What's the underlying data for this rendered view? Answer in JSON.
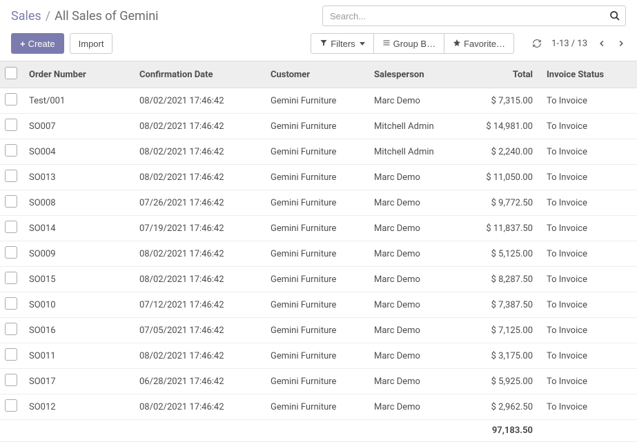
{
  "breadcrumb": {
    "root": "Sales",
    "sep": "/",
    "current": "All Sales of Gemini"
  },
  "search": {
    "placeholder": "Search..."
  },
  "buttons": {
    "create": "Create",
    "import": "Import",
    "filters": "Filters",
    "groupby": "Group B…",
    "favorites": "Favorite…"
  },
  "pager": {
    "text": "1-13 / 13"
  },
  "columns": {
    "order": "Order Number",
    "date": "Confirmation Date",
    "customer": "Customer",
    "salesperson": "Salesperson",
    "total": "Total",
    "invoice": "Invoice Status"
  },
  "rows": [
    {
      "order": "Test/001",
      "date": "08/02/2021 17:46:42",
      "customer": "Gemini Furniture",
      "salesperson": "Marc Demo",
      "total": "$ 7,315.00",
      "invoice": "To Invoice"
    },
    {
      "order": "SO007",
      "date": "08/02/2021 17:46:42",
      "customer": "Gemini Furniture",
      "salesperson": "Mitchell Admin",
      "total": "$ 14,981.00",
      "invoice": "To Invoice"
    },
    {
      "order": "SO004",
      "date": "08/02/2021 17:46:42",
      "customer": "Gemini Furniture",
      "salesperson": "Mitchell Admin",
      "total": "$ 2,240.00",
      "invoice": "To Invoice"
    },
    {
      "order": "SO013",
      "date": "08/02/2021 17:46:42",
      "customer": "Gemini Furniture",
      "salesperson": "Marc Demo",
      "total": "$ 11,050.00",
      "invoice": "To Invoice"
    },
    {
      "order": "SO008",
      "date": "07/26/2021 17:46:42",
      "customer": "Gemini Furniture",
      "salesperson": "Marc Demo",
      "total": "$ 9,772.50",
      "invoice": "To Invoice"
    },
    {
      "order": "SO014",
      "date": "07/19/2021 17:46:42",
      "customer": "Gemini Furniture",
      "salesperson": "Marc Demo",
      "total": "$ 11,837.50",
      "invoice": "To Invoice"
    },
    {
      "order": "SO009",
      "date": "08/02/2021 17:46:42",
      "customer": "Gemini Furniture",
      "salesperson": "Marc Demo",
      "total": "$ 5,125.00",
      "invoice": "To Invoice"
    },
    {
      "order": "SO015",
      "date": "08/02/2021 17:46:42",
      "customer": "Gemini Furniture",
      "salesperson": "Marc Demo",
      "total": "$ 8,287.50",
      "invoice": "To Invoice"
    },
    {
      "order": "SO010",
      "date": "07/12/2021 17:46:42",
      "customer": "Gemini Furniture",
      "salesperson": "Marc Demo",
      "total": "$ 7,387.50",
      "invoice": "To Invoice"
    },
    {
      "order": "SO016",
      "date": "07/05/2021 17:46:42",
      "customer": "Gemini Furniture",
      "salesperson": "Marc Demo",
      "total": "$ 7,125.00",
      "invoice": "To Invoice"
    },
    {
      "order": "SO011",
      "date": "08/02/2021 17:46:42",
      "customer": "Gemini Furniture",
      "salesperson": "Marc Demo",
      "total": "$ 3,175.00",
      "invoice": "To Invoice"
    },
    {
      "order": "SO017",
      "date": "06/28/2021 17:46:42",
      "customer": "Gemini Furniture",
      "salesperson": "Marc Demo",
      "total": "$ 5,925.00",
      "invoice": "To Invoice"
    },
    {
      "order": "SO012",
      "date": "08/02/2021 17:46:42",
      "customer": "Gemini Furniture",
      "salesperson": "Marc Demo",
      "total": "$ 2,962.50",
      "invoice": "To Invoice"
    }
  ],
  "footer": {
    "total": "97,183.50"
  }
}
